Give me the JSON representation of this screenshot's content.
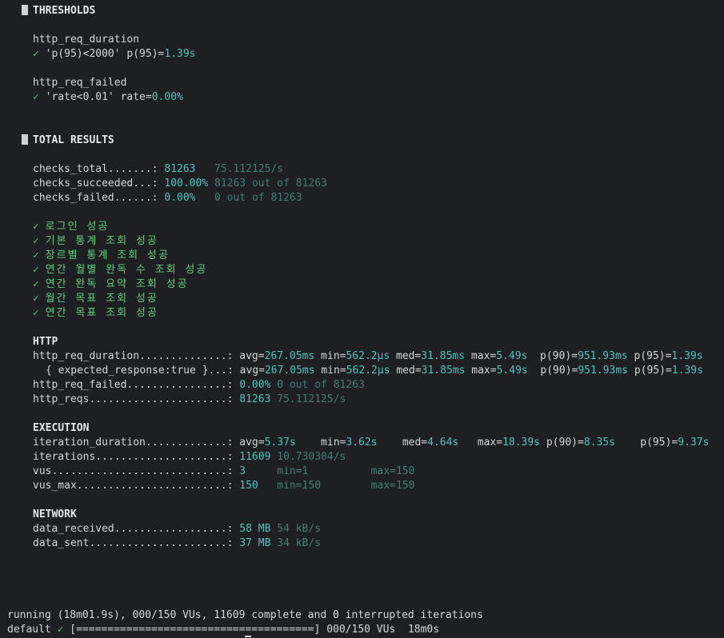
{
  "thresholds": {
    "title": "THRESHOLDS",
    "items": [
      {
        "metric": "http_req_duration",
        "check": "✓",
        "rule": "'p(95)<2000'",
        "label": "p(95)=",
        "value": "1.39s"
      },
      {
        "metric": "http_req_failed",
        "check": "✓",
        "rule": "'rate<0.01'",
        "label": "rate=",
        "value": "0.00%"
      }
    ]
  },
  "total_results": {
    "title": "TOTAL RESULTS",
    "checks": [
      {
        "name": "checks_total.......:",
        "value": "81263",
        "extra": "75.112125/s"
      },
      {
        "name": "checks_succeeded...:",
        "value": "100.00%",
        "extra": "81263 out of 81263"
      },
      {
        "name": "checks_failed......:",
        "value": "0.00%",
        "extra": "0 out of 81263"
      }
    ],
    "check_list_mark": "✓",
    "check_list": [
      "로그인 성공",
      "기본 통계 조회 성공",
      "장르별 통계 조회 성공",
      "연간 월별 완독 수 조회 성공",
      "연간 완독 요약 조회 성공",
      "월간 목표 조회 성공",
      "연간 목표 조회 성공"
    ]
  },
  "http": {
    "title": "HTTP",
    "duration": {
      "name": "http_req_duration..............:",
      "avg_l": "avg=",
      "avg": "267.05ms",
      "min_l": "min=",
      "min": "562.2µs",
      "med_l": "med=",
      "med": "31.85ms",
      "max_l": "max=",
      "max": "5.49s",
      "p90_l": "p(90)=",
      "p90": "951.93ms",
      "p95_l": "p(95)=",
      "p95": "1.39s"
    },
    "expected": {
      "name": "{ expected_response:true }...:",
      "avg_l": "avg=",
      "avg": "267.05ms",
      "min_l": "min=",
      "min": "562.2µs",
      "med_l": "med=",
      "med": "31.85ms",
      "max_l": "max=",
      "max": "5.49s",
      "p90_l": "p(90)=",
      "p90": "951.93ms",
      "p95_l": "p(95)=",
      "p95": "1.39s"
    },
    "failed": {
      "name": "http_req_failed................:",
      "value": "0.00%",
      "extra": "0 out of 81263"
    },
    "reqs": {
      "name": "http_reqs......................:",
      "value": "81263",
      "extra": "75.112125/s"
    }
  },
  "execution": {
    "title": "EXECUTION",
    "iteration": {
      "name": "iteration_duration.............:",
      "avg_l": "avg=",
      "avg": "5.37s",
      "min_l": "min=",
      "min": "3.62s",
      "med_l": "med=",
      "med": "4.64s",
      "max_l": "max=",
      "max": "18.39s",
      "p90_l": "p(90)=",
      "p90": "8.35s",
      "p95_l": "p(95)=",
      "p95": "9.37s"
    },
    "iterations": {
      "name": "iterations.....................:",
      "value": "11609",
      "extra": "10.730304/s"
    },
    "vus": {
      "name": "vus............................:",
      "value": "3",
      "min": "min=1",
      "max": "max=150"
    },
    "vus_max": {
      "name": "vus_max........................:",
      "value": "150",
      "min": "min=150",
      "max": "max=150"
    }
  },
  "network": {
    "title": "NETWORK",
    "received": {
      "name": "data_received..................:",
      "value": "58 MB",
      "extra": "54 kB/s"
    },
    "sent": {
      "name": "data_sent......................:",
      "value": "37 MB",
      "extra": "34 kB/s"
    }
  },
  "footer": {
    "running": "running (18m01.9s), 000/150 VUs, 11609 complete and 0 interrupted iterations",
    "scenario": "default",
    "check": "✓",
    "progress": "[======================================]",
    "vus": "000/150 VUs",
    "time": "18m0s",
    "progress_fraction": 1.0
  }
}
